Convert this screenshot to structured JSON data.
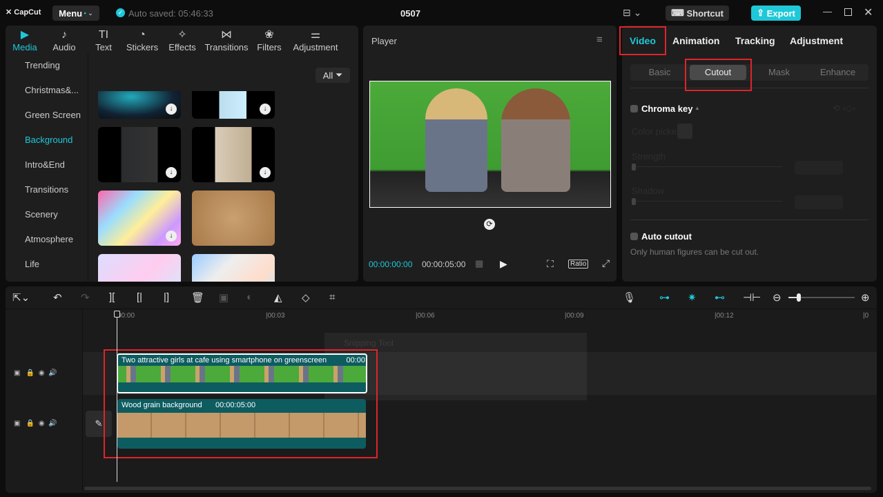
{
  "app": {
    "logo": "CapCut",
    "menu_label": "Menu",
    "autosave": "Auto saved: 05:46:33",
    "project_title": "0507",
    "shortcut_label": "Shortcut",
    "export_label": "Export",
    "accent": "#1fc8d8"
  },
  "toolbar": [
    {
      "label": "Media",
      "icon": "▶"
    },
    {
      "label": "Audio",
      "icon": "♪"
    },
    {
      "label": "Text",
      "icon": "TI"
    },
    {
      "label": "Stickers",
      "icon": "◔"
    },
    {
      "label": "Effects",
      "icon": "✧"
    },
    {
      "label": "Transitions",
      "icon": "⋈"
    },
    {
      "label": "Filters",
      "icon": "❀"
    },
    {
      "label": "Adjustment",
      "icon": "⚌"
    }
  ],
  "categories": [
    "Trending",
    "Christmas&...",
    "Green Screen",
    "Background",
    "Intro&End",
    "Transitions",
    "Scenery",
    "Atmosphere",
    "Life"
  ],
  "filter_label": "All",
  "player": {
    "title": "Player",
    "current_time": "00:00:00:00",
    "total_time": "00:00:05:00",
    "ratio_label": "Ratio"
  },
  "right": {
    "tabs": [
      "Video",
      "Animation",
      "Tracking",
      "Adjustment"
    ],
    "subtabs": [
      "Basic",
      "Cutout",
      "Mask",
      "Enhance"
    ],
    "chroma_key": "Chroma key",
    "color_picker": "Color picker",
    "strength": "Strength",
    "shadow": "Shadow",
    "auto_cutout": "Auto cutout",
    "auto_cutout_desc": "Only human figures can be cut out."
  },
  "timeline": {
    "ruler": [
      "00:00",
      "|00:03",
      "|00:06",
      "|00:09",
      "|00:12",
      "|0"
    ],
    "snipping": "Snipping Tool",
    "clip1": {
      "title": "Two attractive girls at cafe using smartphone on greenscreen",
      "duration": "00:00"
    },
    "clip2": {
      "title": "Wood grain background",
      "duration": "00:00:05:00"
    }
  }
}
